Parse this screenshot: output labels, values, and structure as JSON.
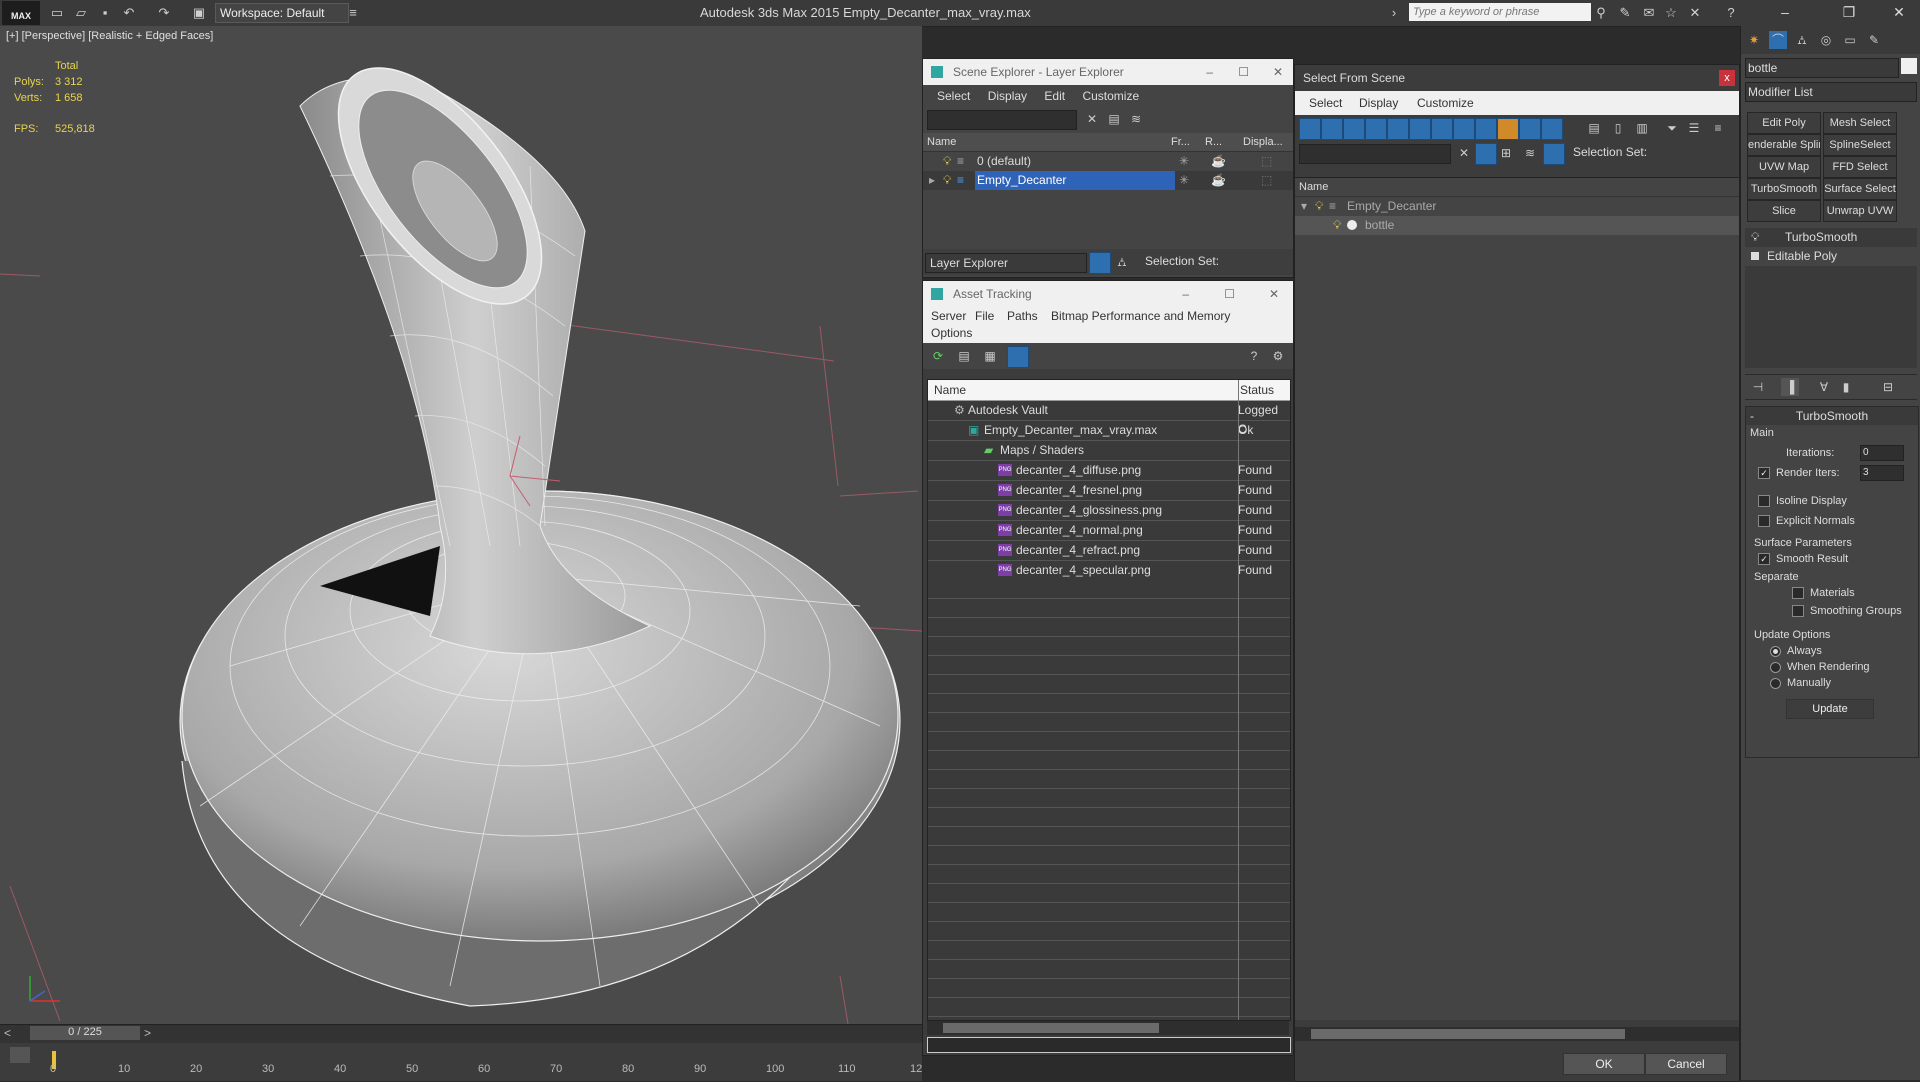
{
  "app": {
    "logo": "MAX",
    "workspace": "Workspace: Default",
    "title": "Autodesk 3ds Max  2015     Empty_Decanter_max_vray.max",
    "search_placeholder": "Type a keyword or phrase"
  },
  "viewport": {
    "label": "[+] [Perspective] [Realistic + Edged Faces]",
    "stats": {
      "total_label": "Total",
      "polys_label": "Polys:",
      "polys": "3 312",
      "verts_label": "Verts:",
      "verts": "1 658",
      "fps_label": "FPS:",
      "fps": "525,818"
    }
  },
  "timeline": {
    "frame": "0 / 225",
    "ticks": [
      "0",
      "10",
      "20",
      "30",
      "40",
      "50",
      "60",
      "70",
      "80",
      "90",
      "100",
      "110",
      "12"
    ]
  },
  "scene_explorer": {
    "title": "Scene Explorer - Layer Explorer",
    "menu": [
      "Select",
      "Display",
      "Edit",
      "Customize"
    ],
    "columns": [
      "Name",
      "Fr...",
      "R...",
      "Displa..."
    ],
    "rows": [
      "0 (default)",
      "Empty_Decanter"
    ],
    "footer_mode": "Layer Explorer",
    "selection_set_label": "Selection Set:"
  },
  "asset_tracking": {
    "title": "Asset Tracking",
    "menu": [
      "Server",
      "File",
      "Paths",
      "Bitmap Performance and Memory"
    ],
    "menu2": "Options",
    "columns": [
      "Name",
      "Status"
    ],
    "rows": [
      {
        "name": "Autodesk Vault",
        "status": "Logged C"
      },
      {
        "name": "Empty_Decanter_max_vray.max",
        "status": "Ok"
      },
      {
        "name": "Maps / Shaders",
        "status": ""
      },
      {
        "name": "decanter_4_diffuse.png",
        "status": "Found"
      },
      {
        "name": "decanter_4_fresnel.png",
        "status": "Found"
      },
      {
        "name": "decanter_4_glossiness.png",
        "status": "Found"
      },
      {
        "name": "decanter_4_normal.png",
        "status": "Found"
      },
      {
        "name": "decanter_4_refract.png",
        "status": "Found"
      },
      {
        "name": "decanter_4_specular.png",
        "status": "Found"
      }
    ]
  },
  "select_from_scene": {
    "title": "Select From Scene",
    "close": "x",
    "menu": [
      "Select",
      "Display",
      "Customize"
    ],
    "selection_set_label": "Selection Set:",
    "column": "Name",
    "tree": [
      "Empty_Decanter",
      "bottle"
    ],
    "ok": "OK",
    "cancel": "Cancel"
  },
  "command_panel": {
    "object_name": "bottle",
    "modifier_list": "Modifier List",
    "buttons": [
      "Edit Poly",
      "Mesh Select",
      "enderable Splir",
      "SplineSelect",
      "UVW Map",
      "FFD Select",
      "TurboSmooth",
      "Surface Select",
      "Slice",
      "Unwrap UVW"
    ],
    "stack": [
      "TurboSmooth",
      "Editable Poly"
    ],
    "rollout": {
      "title": "TurboSmooth",
      "main": "Main",
      "iterations_label": "Iterations:",
      "iterations": "0",
      "render_iters_label": "Render Iters:",
      "render_iters": "3",
      "isoline": "Isoline Display",
      "explicit": "Explicit Normals",
      "surface": "Surface Parameters",
      "smooth": "Smooth Result",
      "separate": "Separate",
      "materials": "Materials",
      "smoothing": "Smoothing Groups",
      "update_options": "Update Options",
      "always": "Always",
      "when_rendering": "When Rendering",
      "manually": "Manually",
      "update": "Update"
    }
  }
}
